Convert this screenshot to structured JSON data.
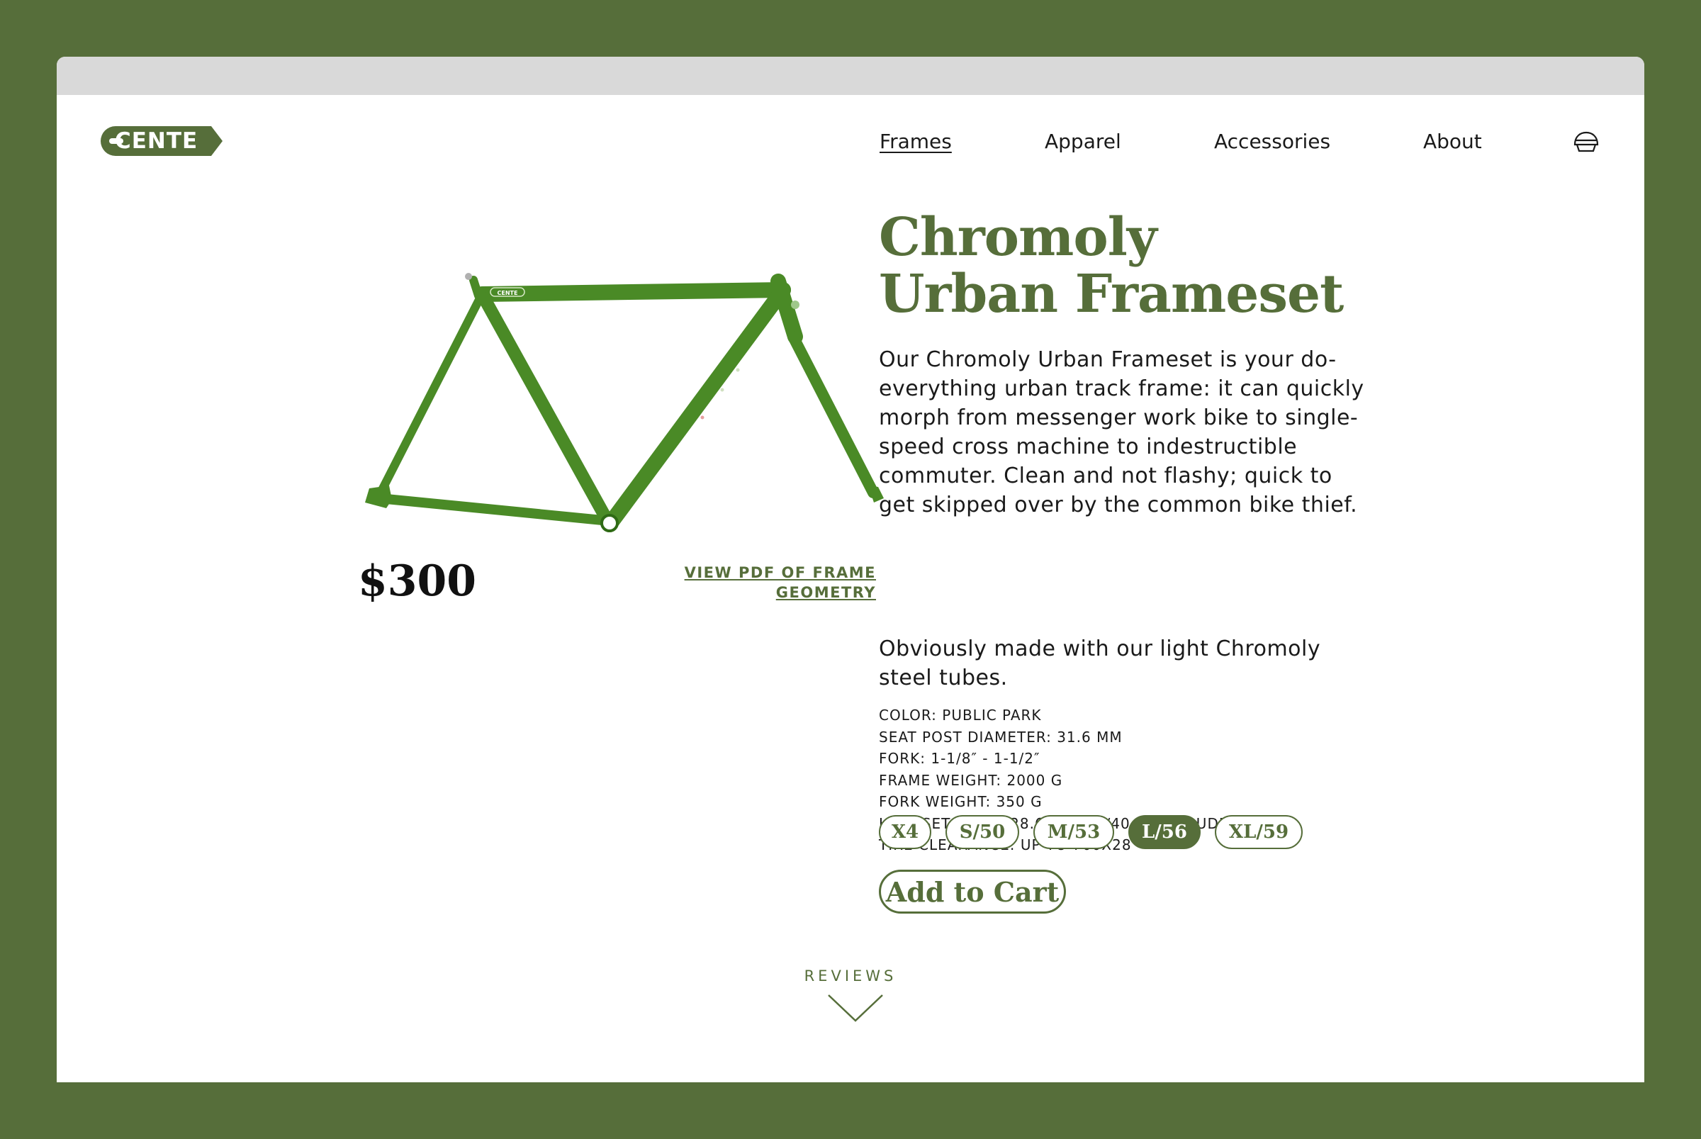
{
  "brand": {
    "name": "CENTE",
    "color": "#566e3a",
    "icon": "cente-logo"
  },
  "nav": {
    "items": [
      {
        "label": "Frames",
        "active": true
      },
      {
        "label": "Apparel",
        "active": false
      },
      {
        "label": "Accessories",
        "active": false
      },
      {
        "label": "About",
        "active": false
      }
    ],
    "cart_icon": "helmet-cart-icon"
  },
  "product": {
    "image_icon": "bike-frame-illustration",
    "frame_decal_text": "CENTE",
    "title": "Chromoly Urban Frameset",
    "title_line1": "Chromoly",
    "title_line2": "Urban Frameset",
    "price": "$300",
    "geometry_link": "VIEW PDF OF FRAME GEOMETRY",
    "description": "Our Chromoly Urban Frameset is your do-everything urban track frame: it can quickly morph from messenger work bike  to single-speed cross machine to indestructible commuter. Clean and not flashy; quick to get skipped over by the common bike thief.",
    "description2": "Obviously made with our light Chromoly steel tubes.",
    "specs": [
      "COLOR: PUBLIC PARK",
      "SEAT POST DIAMETER: 31.6 MM",
      "FORK: 1-1/8″ - 1-1/2″",
      "FRAME WEIGHT: 2000 G",
      "FORK WEIGHT: 350 G",
      "HEADSET: ZS 44/28.6 | EC 44/40 (IS INCLUDED)",
      "TIRE CLEARANCE: UP TO 700X28"
    ],
    "sizes": [
      {
        "label": "X4",
        "selected": false
      },
      {
        "label": "S/50",
        "selected": false
      },
      {
        "label": "M/53",
        "selected": false
      },
      {
        "label": "L/56",
        "selected": true
      },
      {
        "label": "XL/59",
        "selected": false
      }
    ],
    "add_to_cart": "Add to Cart"
  },
  "reviews": {
    "label": "REVIEWS",
    "icon": "chevron-down-icon"
  },
  "colors": {
    "page_background": "#566e3a",
    "accent": "#566e3a",
    "frame_green": "#4a8a26",
    "titlebar": "#d9d9d9"
  }
}
